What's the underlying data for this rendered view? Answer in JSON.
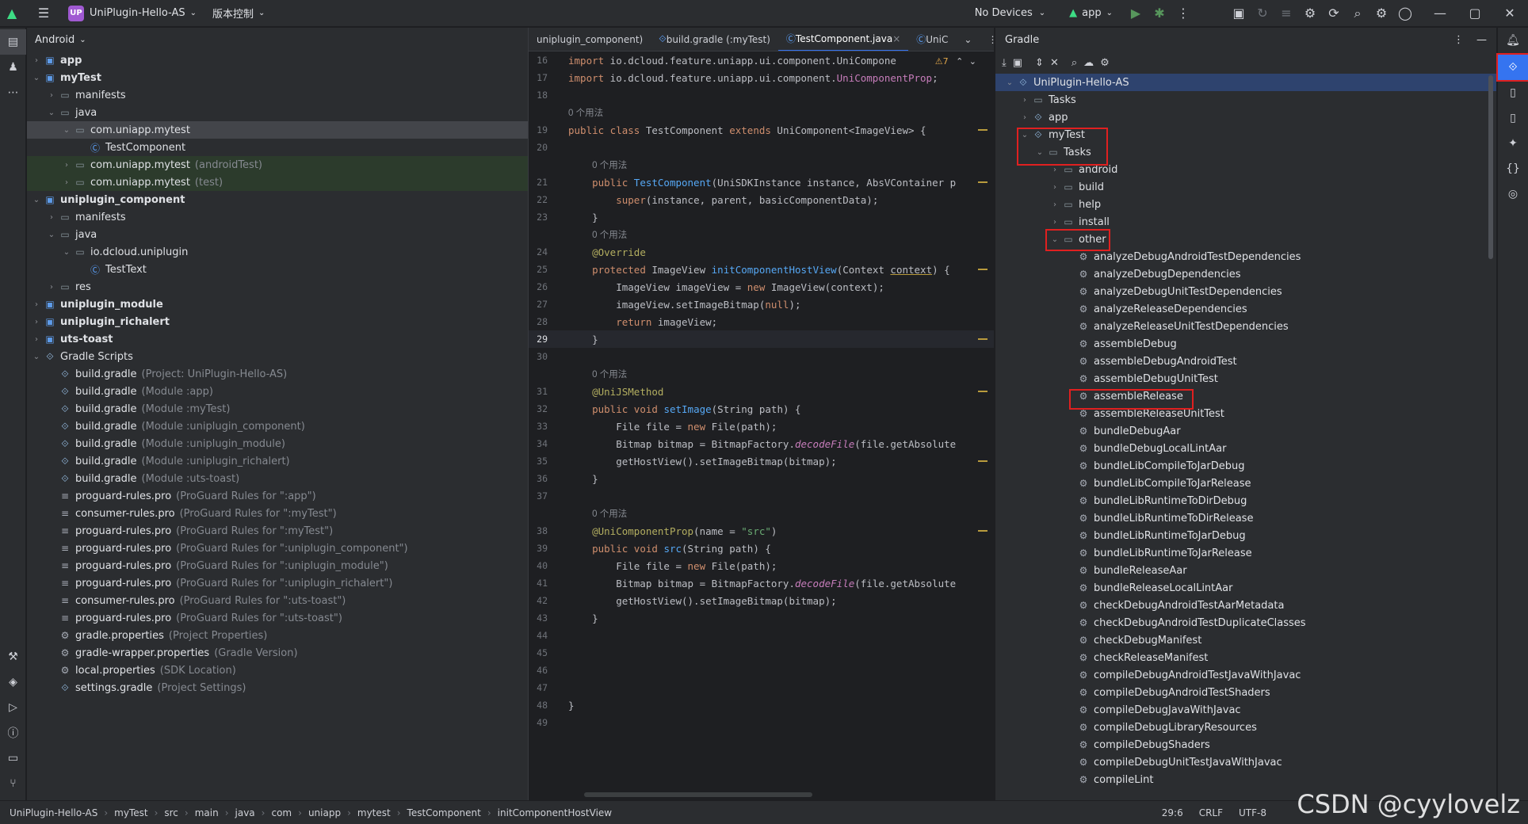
{
  "titlebar": {
    "project_badge": "UP",
    "project_name": "UniPlugin-Hello-AS",
    "vcs": "版本控制",
    "devices": "No Devices",
    "run_config": "app"
  },
  "project_panel": {
    "view_mode": "Android",
    "rows": [
      {
        "label": "app",
        "hint": "",
        "depth": 0,
        "arrow": "›",
        "icon": "module",
        "bold": true,
        "state": ""
      },
      {
        "label": "myTest",
        "hint": "",
        "depth": 0,
        "arrow": "⌄",
        "icon": "module",
        "bold": true,
        "state": ""
      },
      {
        "label": "manifests",
        "hint": "",
        "depth": 1,
        "arrow": "›",
        "icon": "folder",
        "bold": false,
        "state": ""
      },
      {
        "label": "java",
        "hint": "",
        "depth": 1,
        "arrow": "⌄",
        "icon": "folder",
        "bold": false,
        "state": ""
      },
      {
        "label": "com.uniapp.mytest",
        "hint": "",
        "depth": 2,
        "arrow": "⌄",
        "icon": "folder",
        "bold": false,
        "state": "sel"
      },
      {
        "label": "TestComponent",
        "hint": "",
        "depth": 3,
        "arrow": "",
        "icon": "class",
        "bold": false,
        "state": ""
      },
      {
        "label": "com.uniapp.mytest",
        "hint": "(androidTest)",
        "depth": 2,
        "arrow": "›",
        "icon": "folder",
        "bold": false,
        "state": "green"
      },
      {
        "label": "com.uniapp.mytest",
        "hint": "(test)",
        "depth": 2,
        "arrow": "›",
        "icon": "folder",
        "bold": false,
        "state": "green"
      },
      {
        "label": "uniplugin_component",
        "hint": "",
        "depth": 0,
        "arrow": "⌄",
        "icon": "module",
        "bold": true,
        "state": ""
      },
      {
        "label": "manifests",
        "hint": "",
        "depth": 1,
        "arrow": "›",
        "icon": "folder",
        "bold": false,
        "state": ""
      },
      {
        "label": "java",
        "hint": "",
        "depth": 1,
        "arrow": "⌄",
        "icon": "folder",
        "bold": false,
        "state": ""
      },
      {
        "label": "io.dcloud.uniplugin",
        "hint": "",
        "depth": 2,
        "arrow": "⌄",
        "icon": "folder",
        "bold": false,
        "state": ""
      },
      {
        "label": "TestText",
        "hint": "",
        "depth": 3,
        "arrow": "",
        "icon": "class",
        "bold": false,
        "state": ""
      },
      {
        "label": "res",
        "hint": "",
        "depth": 1,
        "arrow": "›",
        "icon": "folder",
        "bold": false,
        "state": ""
      },
      {
        "label": "uniplugin_module",
        "hint": "",
        "depth": 0,
        "arrow": "›",
        "icon": "module",
        "bold": true,
        "state": ""
      },
      {
        "label": "uniplugin_richalert",
        "hint": "",
        "depth": 0,
        "arrow": "›",
        "icon": "module",
        "bold": true,
        "state": ""
      },
      {
        "label": "uts-toast",
        "hint": "",
        "depth": 0,
        "arrow": "›",
        "icon": "module",
        "bold": true,
        "state": ""
      },
      {
        "label": "Gradle Scripts",
        "hint": "",
        "depth": 0,
        "arrow": "⌄",
        "icon": "gradle",
        "bold": false,
        "state": ""
      },
      {
        "label": "build.gradle",
        "hint": "(Project: UniPlugin-Hello-AS)",
        "depth": 1,
        "arrow": "",
        "icon": "gradle",
        "bold": false,
        "state": ""
      },
      {
        "label": "build.gradle",
        "hint": "(Module :app)",
        "depth": 1,
        "arrow": "",
        "icon": "gradle",
        "bold": false,
        "state": ""
      },
      {
        "label": "build.gradle",
        "hint": "(Module :myTest)",
        "depth": 1,
        "arrow": "",
        "icon": "gradle",
        "bold": false,
        "state": ""
      },
      {
        "label": "build.gradle",
        "hint": "(Module :uniplugin_component)",
        "depth": 1,
        "arrow": "",
        "icon": "gradle",
        "bold": false,
        "state": ""
      },
      {
        "label": "build.gradle",
        "hint": "(Module :uniplugin_module)",
        "depth": 1,
        "arrow": "",
        "icon": "gradle",
        "bold": false,
        "state": ""
      },
      {
        "label": "build.gradle",
        "hint": "(Module :uniplugin_richalert)",
        "depth": 1,
        "arrow": "",
        "icon": "gradle",
        "bold": false,
        "state": ""
      },
      {
        "label": "build.gradle",
        "hint": "(Module :uts-toast)",
        "depth": 1,
        "arrow": "",
        "icon": "gradle",
        "bold": false,
        "state": ""
      },
      {
        "label": "proguard-rules.pro",
        "hint": "(ProGuard Rules for \":app\")",
        "depth": 1,
        "arrow": "",
        "icon": "file",
        "bold": false,
        "state": ""
      },
      {
        "label": "consumer-rules.pro",
        "hint": "(ProGuard Rules for \":myTest\")",
        "depth": 1,
        "arrow": "",
        "icon": "file",
        "bold": false,
        "state": ""
      },
      {
        "label": "proguard-rules.pro",
        "hint": "(ProGuard Rules for \":myTest\")",
        "depth": 1,
        "arrow": "",
        "icon": "file",
        "bold": false,
        "state": ""
      },
      {
        "label": "proguard-rules.pro",
        "hint": "(ProGuard Rules for \":uniplugin_component\")",
        "depth": 1,
        "arrow": "",
        "icon": "file",
        "bold": false,
        "state": ""
      },
      {
        "label": "proguard-rules.pro",
        "hint": "(ProGuard Rules for \":uniplugin_module\")",
        "depth": 1,
        "arrow": "",
        "icon": "file",
        "bold": false,
        "state": ""
      },
      {
        "label": "proguard-rules.pro",
        "hint": "(ProGuard Rules for \":uniplugin_richalert\")",
        "depth": 1,
        "arrow": "",
        "icon": "file",
        "bold": false,
        "state": ""
      },
      {
        "label": "consumer-rules.pro",
        "hint": "(ProGuard Rules for \":uts-toast\")",
        "depth": 1,
        "arrow": "",
        "icon": "file",
        "bold": false,
        "state": ""
      },
      {
        "label": "proguard-rules.pro",
        "hint": "(ProGuard Rules for \":uts-toast\")",
        "depth": 1,
        "arrow": "",
        "icon": "file",
        "bold": false,
        "state": ""
      },
      {
        "label": "gradle.properties",
        "hint": "(Project Properties)",
        "depth": 1,
        "arrow": "",
        "icon": "gear",
        "bold": false,
        "state": ""
      },
      {
        "label": "gradle-wrapper.properties",
        "hint": "(Gradle Version)",
        "depth": 1,
        "arrow": "",
        "icon": "gear",
        "bold": false,
        "state": ""
      },
      {
        "label": "local.properties",
        "hint": "(SDK Location)",
        "depth": 1,
        "arrow": "",
        "icon": "gear",
        "bold": false,
        "state": ""
      },
      {
        "label": "settings.gradle",
        "hint": "(Project Settings)",
        "depth": 1,
        "arrow": "",
        "icon": "gradle",
        "bold": false,
        "state": ""
      }
    ]
  },
  "editor": {
    "tabs": [
      {
        "label": "uniplugin_component)",
        "active": false
      },
      {
        "label": "build.gradle (:myTest)",
        "active": false
      },
      {
        "label": "TestComponent.java",
        "active": true
      },
      {
        "label": "UniC",
        "active": false
      }
    ],
    "warning_count": "7",
    "lines": [
      {
        "n": "16",
        "html": "<span class='kw'>import</span> io.dcloud.feature.uniapp.ui.component.UniCompone"
      },
      {
        "n": "17",
        "html": "<span class='kw'>import</span> io.dcloud.feature.uniapp.ui.component.<span style='color:#c77dbb'>UniComponentProp</span>;"
      },
      {
        "n": "18",
        "html": ""
      },
      {
        "n": "",
        "html": "<span class='usage'>0 个用法</span>"
      },
      {
        "n": "19",
        "html": "<span class='kw'>public class</span> <span style='color:#bcbec4'>TestComponent</span> <span class='kw'>extends</span> UniComponent&lt;ImageView&gt; {"
      },
      {
        "n": "20",
        "html": ""
      },
      {
        "n": "",
        "html": "    <span class='usage'>0 个用法</span>"
      },
      {
        "n": "21",
        "html": "    <span class='kw'>public</span> <span style='color:#56a8f5'>TestComponent</span>(UniSDKInstance instance, AbsVContainer p"
      },
      {
        "n": "22",
        "html": "        <span class='kw'>super</span>(instance, parent, basicComponentData);"
      },
      {
        "n": "23",
        "html": "    }"
      },
      {
        "n": "",
        "html": "    <span class='usage'>0 个用法</span>"
      },
      {
        "n": "24",
        "html": "    <span class='an'>@Override</span>"
      },
      {
        "n": "25",
        "html": "    <span class='kw'>protected</span> ImageView <span class='fn'>initComponentHostView</span>(Context <u style='text-decoration-color:#b99b3d'>context</u>) {"
      },
      {
        "n": "26",
        "html": "        ImageView imageView = <span class='kw'>new</span> ImageView(context);"
      },
      {
        "n": "27",
        "html": "        imageView.setImageBitmap(<span class='kw'>null</span>);"
      },
      {
        "n": "28",
        "html": "        <span class='kw'>return</span> imageView;"
      },
      {
        "n": "29",
        "html": "    }"
      },
      {
        "n": "30",
        "html": ""
      },
      {
        "n": "",
        "html": "    <span class='usage'>0 个用法</span>"
      },
      {
        "n": "31",
        "html": "    <span class='an'>@UniJSMethod</span>"
      },
      {
        "n": "32",
        "html": "    <span class='kw'>public void</span> <span class='fn'>setImage</span>(String path) {"
      },
      {
        "n": "33",
        "html": "        File file = <span class='kw'>new</span> File(path);"
      },
      {
        "n": "34",
        "html": "        Bitmap bitmap = BitmapFactory.<span class='it'>decodeFile</span>(file.getAbsolute"
      },
      {
        "n": "35",
        "html": "        getHostView().setImageBitmap(bitmap);"
      },
      {
        "n": "36",
        "html": "    }"
      },
      {
        "n": "37",
        "html": ""
      },
      {
        "n": "",
        "html": "    <span class='usage'>0 个用法</span>"
      },
      {
        "n": "38",
        "html": "    <span class='an'>@UniComponentProp</span>(name = <span class='st'>\"src\"</span>)"
      },
      {
        "n": "39",
        "html": "    <span class='kw'>public void</span> <span class='fn'>src</span>(String path) {"
      },
      {
        "n": "40",
        "html": "        File file = <span class='kw'>new</span> File(path);"
      },
      {
        "n": "41",
        "html": "        Bitmap bitmap = BitmapFactory.<span class='it'>decodeFile</span>(file.getAbsolute"
      },
      {
        "n": "42",
        "html": "        getHostView().setImageBitmap(bitmap);"
      },
      {
        "n": "43",
        "html": "    }"
      },
      {
        "n": "44",
        "html": ""
      },
      {
        "n": "45",
        "html": ""
      },
      {
        "n": "46",
        "html": ""
      },
      {
        "n": "47",
        "html": ""
      },
      {
        "n": "48",
        "html": "}"
      },
      {
        "n": "49",
        "html": ""
      }
    ],
    "current_line": "29"
  },
  "gradle": {
    "title": "Gradle",
    "rows": [
      {
        "label": "UniPlugin-Hello-AS",
        "depth": 0,
        "arrow": "⌄",
        "icon": "gradle",
        "sel": true
      },
      {
        "label": "Tasks",
        "depth": 1,
        "arrow": "›",
        "icon": "folder",
        "sel": false
      },
      {
        "label": "app",
        "depth": 1,
        "arrow": "›",
        "icon": "gradle",
        "sel": false
      },
      {
        "label": "myTest",
        "depth": 1,
        "arrow": "⌄",
        "icon": "gradle",
        "sel": false
      },
      {
        "label": "Tasks",
        "depth": 2,
        "arrow": "⌄",
        "icon": "folder",
        "sel": false
      },
      {
        "label": "android",
        "depth": 3,
        "arrow": "›",
        "icon": "folder",
        "sel": false
      },
      {
        "label": "build",
        "depth": 3,
        "arrow": "›",
        "icon": "folder",
        "sel": false
      },
      {
        "label": "help",
        "depth": 3,
        "arrow": "›",
        "icon": "folder",
        "sel": false
      },
      {
        "label": "install",
        "depth": 3,
        "arrow": "›",
        "icon": "folder",
        "sel": false
      },
      {
        "label": "other",
        "depth": 3,
        "arrow": "⌄",
        "icon": "folder",
        "sel": false
      },
      {
        "label": "analyzeDebugAndroidTestDependencies",
        "depth": 4,
        "arrow": "",
        "icon": "gear",
        "sel": false
      },
      {
        "label": "analyzeDebugDependencies",
        "depth": 4,
        "arrow": "",
        "icon": "gear",
        "sel": false
      },
      {
        "label": "analyzeDebugUnitTestDependencies",
        "depth": 4,
        "arrow": "",
        "icon": "gear",
        "sel": false
      },
      {
        "label": "analyzeReleaseDependencies",
        "depth": 4,
        "arrow": "",
        "icon": "gear",
        "sel": false
      },
      {
        "label": "analyzeReleaseUnitTestDependencies",
        "depth": 4,
        "arrow": "",
        "icon": "gear",
        "sel": false
      },
      {
        "label": "assembleDebug",
        "depth": 4,
        "arrow": "",
        "icon": "gear",
        "sel": false
      },
      {
        "label": "assembleDebugAndroidTest",
        "depth": 4,
        "arrow": "",
        "icon": "gear",
        "sel": false
      },
      {
        "label": "assembleDebugUnitTest",
        "depth": 4,
        "arrow": "",
        "icon": "gear",
        "sel": false
      },
      {
        "label": "assembleRelease",
        "depth": 4,
        "arrow": "",
        "icon": "gear",
        "sel": false
      },
      {
        "label": "assembleReleaseUnitTest",
        "depth": 4,
        "arrow": "",
        "icon": "gear",
        "sel": false
      },
      {
        "label": "bundleDebugAar",
        "depth": 4,
        "arrow": "",
        "icon": "gear",
        "sel": false
      },
      {
        "label": "bundleDebugLocalLintAar",
        "depth": 4,
        "arrow": "",
        "icon": "gear",
        "sel": false
      },
      {
        "label": "bundleLibCompileToJarDebug",
        "depth": 4,
        "arrow": "",
        "icon": "gear",
        "sel": false
      },
      {
        "label": "bundleLibCompileToJarRelease",
        "depth": 4,
        "arrow": "",
        "icon": "gear",
        "sel": false
      },
      {
        "label": "bundleLibRuntimeToDirDebug",
        "depth": 4,
        "arrow": "",
        "icon": "gear",
        "sel": false
      },
      {
        "label": "bundleLibRuntimeToDirRelease",
        "depth": 4,
        "arrow": "",
        "icon": "gear",
        "sel": false
      },
      {
        "label": "bundleLibRuntimeToJarDebug",
        "depth": 4,
        "arrow": "",
        "icon": "gear",
        "sel": false
      },
      {
        "label": "bundleLibRuntimeToJarRelease",
        "depth": 4,
        "arrow": "",
        "icon": "gear",
        "sel": false
      },
      {
        "label": "bundleReleaseAar",
        "depth": 4,
        "arrow": "",
        "icon": "gear",
        "sel": false
      },
      {
        "label": "bundleReleaseLocalLintAar",
        "depth": 4,
        "arrow": "",
        "icon": "gear",
        "sel": false
      },
      {
        "label": "checkDebugAndroidTestAarMetadata",
        "depth": 4,
        "arrow": "",
        "icon": "gear",
        "sel": false
      },
      {
        "label": "checkDebugAndroidTestDuplicateClasses",
        "depth": 4,
        "arrow": "",
        "icon": "gear",
        "sel": false
      },
      {
        "label": "checkDebugManifest",
        "depth": 4,
        "arrow": "",
        "icon": "gear",
        "sel": false
      },
      {
        "label": "checkReleaseManifest",
        "depth": 4,
        "arrow": "",
        "icon": "gear",
        "sel": false
      },
      {
        "label": "compileDebugAndroidTestJavaWithJavac",
        "depth": 4,
        "arrow": "",
        "icon": "gear",
        "sel": false
      },
      {
        "label": "compileDebugAndroidTestShaders",
        "depth": 4,
        "arrow": "",
        "icon": "gear",
        "sel": false
      },
      {
        "label": "compileDebugJavaWithJavac",
        "depth": 4,
        "arrow": "",
        "icon": "gear",
        "sel": false
      },
      {
        "label": "compileDebugLibraryResources",
        "depth": 4,
        "arrow": "",
        "icon": "gear",
        "sel": false
      },
      {
        "label": "compileDebugShaders",
        "depth": 4,
        "arrow": "",
        "icon": "gear",
        "sel": false
      },
      {
        "label": "compileDebugUnitTestJavaWithJavac",
        "depth": 4,
        "arrow": "",
        "icon": "gear",
        "sel": false
      },
      {
        "label": "compileLint",
        "depth": 4,
        "arrow": "",
        "icon": "gear",
        "sel": false
      }
    ]
  },
  "statusbar": {
    "crumbs": [
      "UniPlugin-Hello-AS",
      "myTest",
      "src",
      "main",
      "java",
      "com",
      "uniapp",
      "mytest",
      "TestComponent",
      "initComponentHostView"
    ],
    "position": "29:6",
    "line_ending": "CRLF",
    "encoding": "UTF-8"
  },
  "watermark": "CSDN @cyylovelz"
}
